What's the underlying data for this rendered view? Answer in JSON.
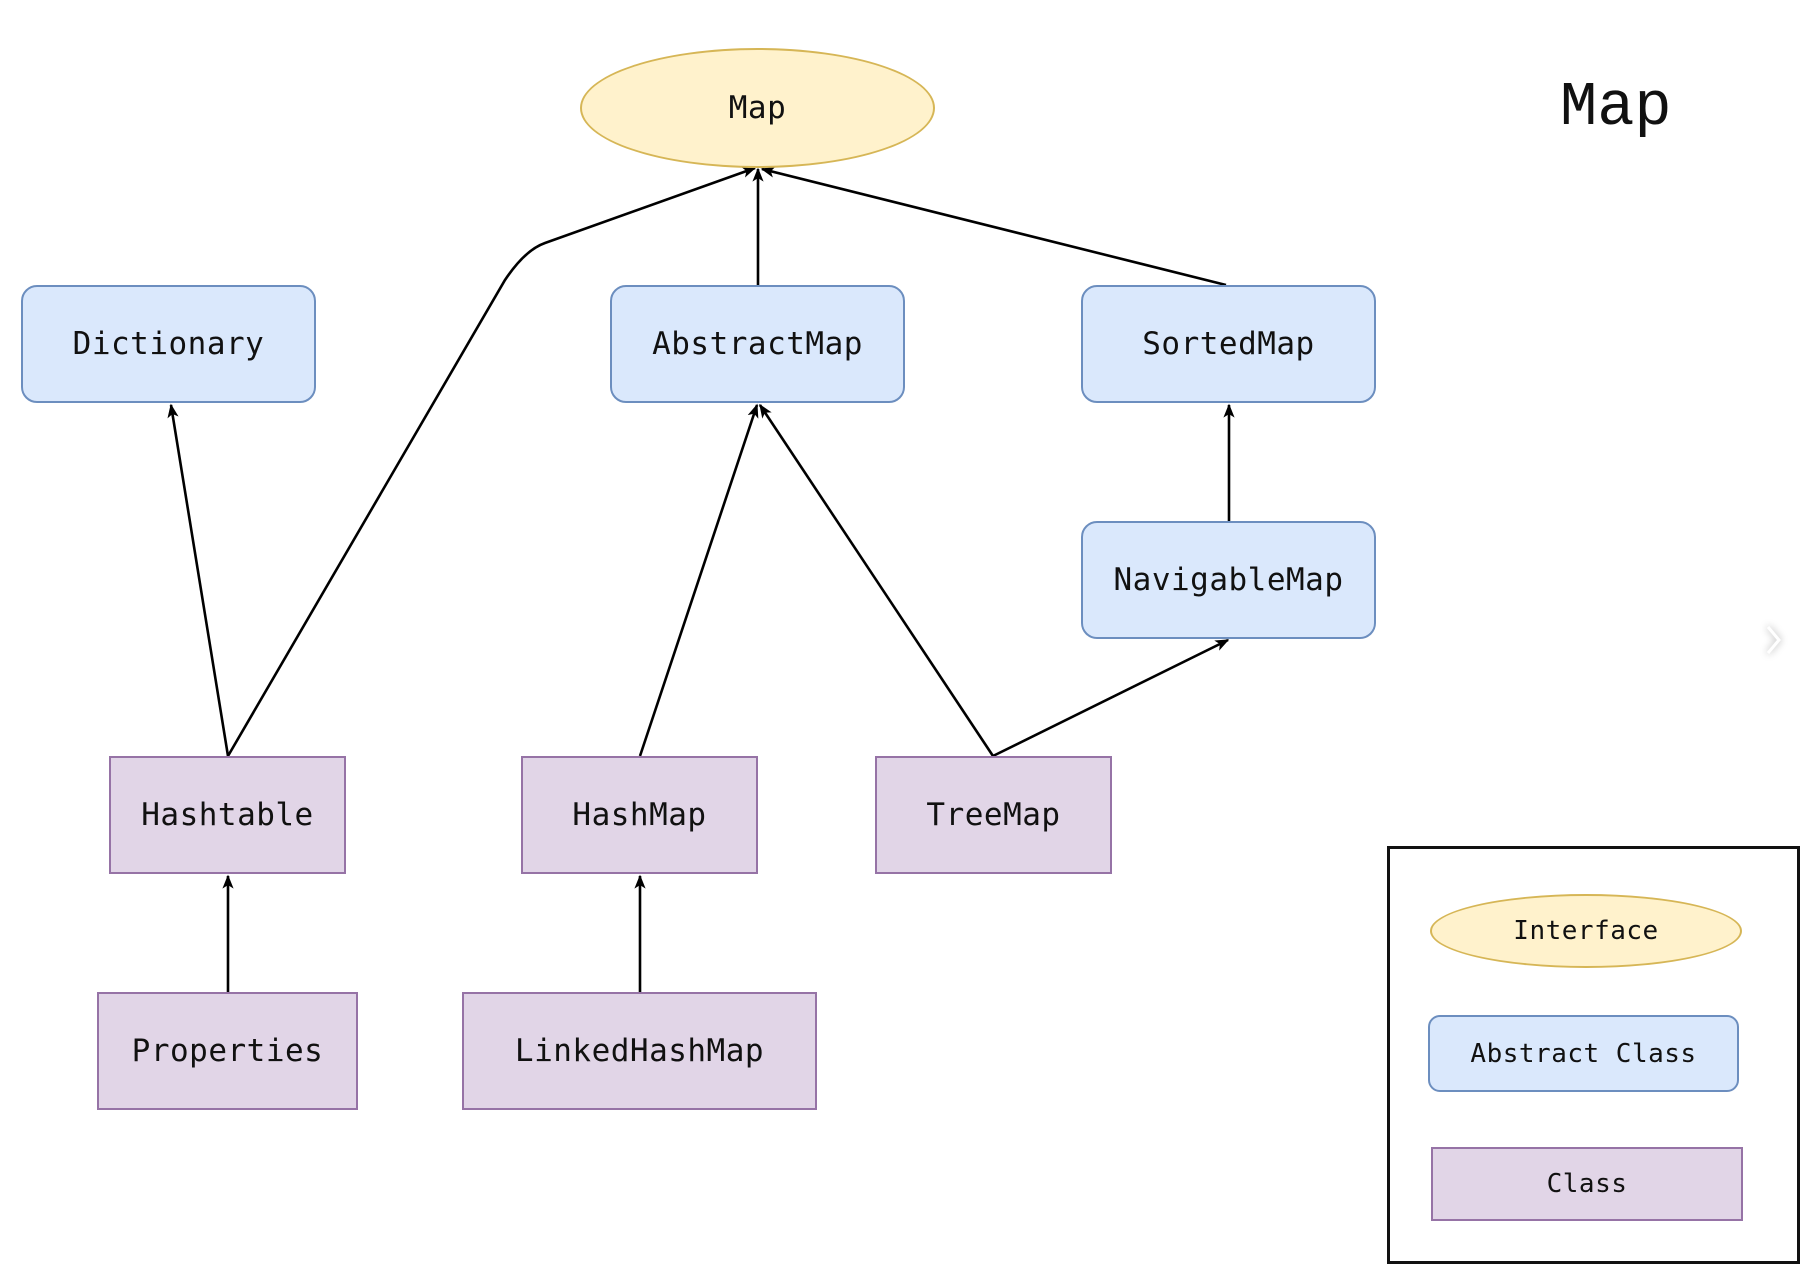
{
  "diagram": {
    "title": "Map",
    "nodes": [
      {
        "id": "Map",
        "label": "Map",
        "kind": "interface"
      },
      {
        "id": "Dictionary",
        "label": "Dictionary",
        "kind": "abstract"
      },
      {
        "id": "AbstractMap",
        "label": "AbstractMap",
        "kind": "abstract"
      },
      {
        "id": "SortedMap",
        "label": "SortedMap",
        "kind": "abstract"
      },
      {
        "id": "NavigableMap",
        "label": "NavigableMap",
        "kind": "abstract"
      },
      {
        "id": "Hashtable",
        "label": "Hashtable",
        "kind": "class"
      },
      {
        "id": "HashMap",
        "label": "HashMap",
        "kind": "class"
      },
      {
        "id": "TreeMap",
        "label": "TreeMap",
        "kind": "class"
      },
      {
        "id": "Properties",
        "label": "Properties",
        "kind": "class"
      },
      {
        "id": "LinkedHashMap",
        "label": "LinkedHashMap",
        "kind": "class"
      }
    ],
    "edges": [
      {
        "from": "Hashtable",
        "to": "Dictionary"
      },
      {
        "from": "Hashtable",
        "to": "Map"
      },
      {
        "from": "AbstractMap",
        "to": "Map"
      },
      {
        "from": "SortedMap",
        "to": "Map"
      },
      {
        "from": "HashMap",
        "to": "AbstractMap"
      },
      {
        "from": "TreeMap",
        "to": "AbstractMap"
      },
      {
        "from": "NavigableMap",
        "to": "SortedMap"
      },
      {
        "from": "TreeMap",
        "to": "NavigableMap"
      },
      {
        "from": "Properties",
        "to": "Hashtable"
      },
      {
        "from": "LinkedHashMap",
        "to": "HashMap"
      }
    ],
    "legend": {
      "interface": "Interface",
      "abstract": "Abstract Class",
      "class": "Class"
    }
  },
  "colors": {
    "interface_fill": "#fff2cc",
    "interface_stroke": "#d6b656",
    "abstract_fill": "#dae8fc",
    "abstract_stroke": "#6c8ebf",
    "class_fill": "#e1d5e7",
    "class_stroke": "#9673a6",
    "edge": "#000000"
  },
  "navigation": {
    "next_icon": "chevron-right-icon"
  }
}
